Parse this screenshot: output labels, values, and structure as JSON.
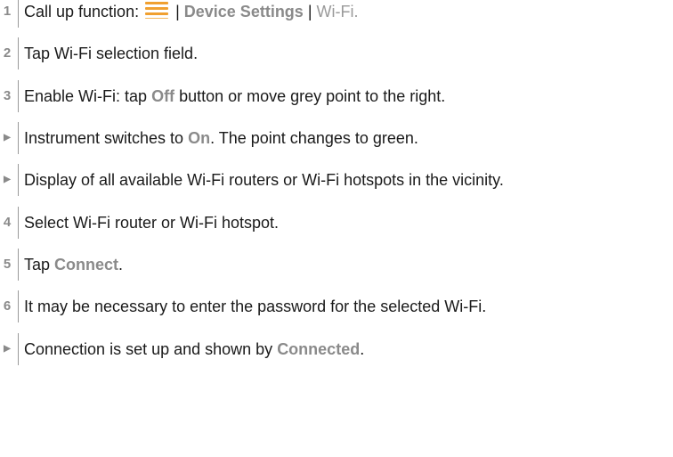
{
  "steps": [
    {
      "marker": "1",
      "kind": "number",
      "parts": [
        {
          "t": "Call up function: ",
          "s": "plain"
        },
        {
          "t": "",
          "s": "icon",
          "icon": "menu-icon"
        },
        {
          "t": " | ",
          "s": "plain"
        },
        {
          "t": "Device Settings",
          "s": "hl"
        },
        {
          "t": " | ",
          "s": "plain"
        },
        {
          "t": "Wi-Fi.",
          "s": "hl-plain"
        }
      ]
    },
    {
      "marker": "2",
      "kind": "number",
      "parts": [
        {
          "t": "Tap Wi-Fi selection field.",
          "s": "plain"
        }
      ]
    },
    {
      "marker": "3",
      "kind": "number",
      "parts": [
        {
          "t": "Enable Wi-Fi: tap ",
          "s": "plain"
        },
        {
          "t": "Off",
          "s": "hl"
        },
        {
          "t": " button or move grey point to the right.",
          "s": "plain"
        }
      ]
    },
    {
      "marker": "▶",
      "kind": "result",
      "parts": [
        {
          "t": "Instrument switches to ",
          "s": "plain"
        },
        {
          "t": "On",
          "s": "hl"
        },
        {
          "t": ". The point changes to green.",
          "s": "plain"
        }
      ]
    },
    {
      "marker": "▶",
      "kind": "result",
      "parts": [
        {
          "t": "Display of all available Wi-Fi routers or Wi-Fi hotspots in the vicinity.",
          "s": "plain"
        }
      ]
    },
    {
      "marker": "4",
      "kind": "number",
      "parts": [
        {
          "t": "Select Wi-Fi router or Wi-Fi hotspot.",
          "s": "plain"
        }
      ]
    },
    {
      "marker": "5",
      "kind": "number",
      "parts": [
        {
          "t": "Tap ",
          "s": "plain"
        },
        {
          "t": "Connect",
          "s": "hl"
        },
        {
          "t": ".",
          "s": "plain"
        }
      ]
    },
    {
      "marker": "6",
      "kind": "number",
      "parts": [
        {
          "t": "It may be necessary to enter the password for the selected Wi-Fi.",
          "s": "plain"
        }
      ]
    },
    {
      "marker": "▶",
      "kind": "result",
      "parts": [
        {
          "t": "Connection is set up and shown by ",
          "s": "plain"
        },
        {
          "t": "Connected",
          "s": "hl"
        },
        {
          "t": ".",
          "s": "plain"
        }
      ]
    }
  ],
  "colors": {
    "highlight": "#8a8a8a",
    "menu_icon": "#f0a030",
    "divider": "#9a9a9a"
  }
}
